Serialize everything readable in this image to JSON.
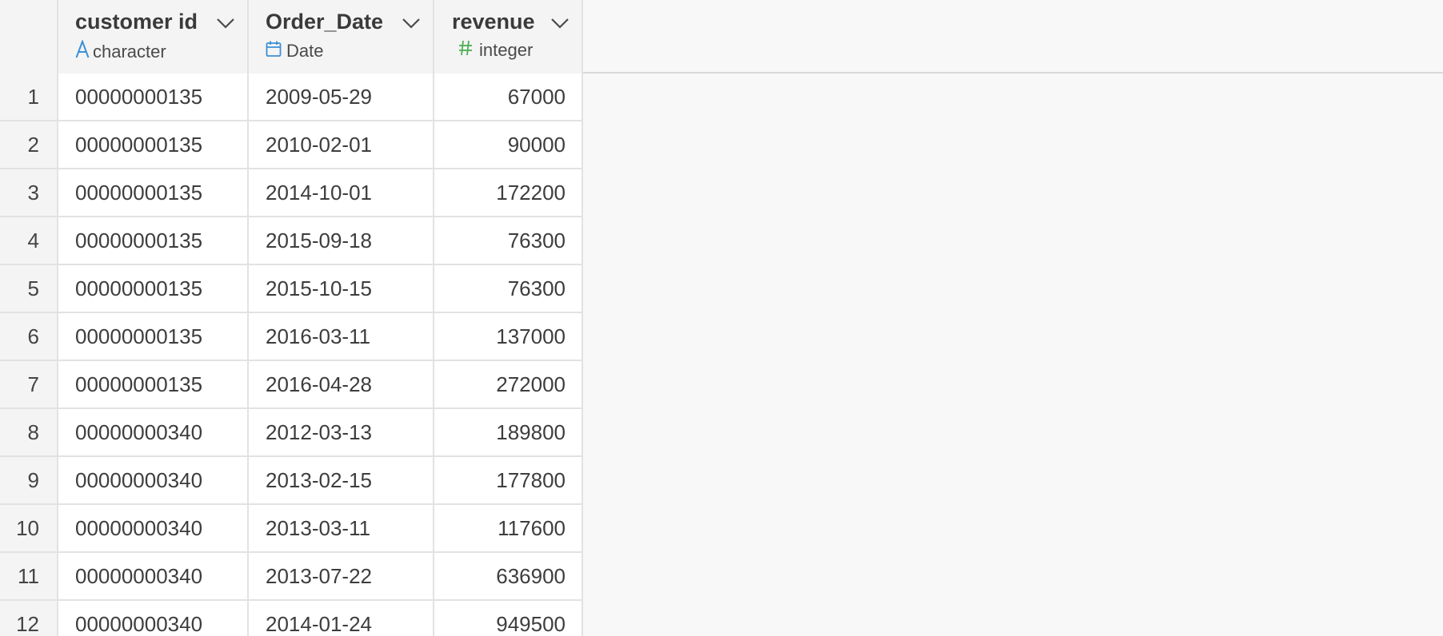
{
  "columns": [
    {
      "title": "customer id",
      "type": "character",
      "type_icon": "letter-a-icon"
    },
    {
      "title": "Order_Date",
      "type": "Date",
      "type_icon": "calendar-icon"
    },
    {
      "title": "revenue",
      "type": "integer",
      "type_icon": "hash-icon"
    }
  ],
  "type_colors": {
    "character": "#3b8fd6",
    "Date": "#3b8fd6",
    "integer": "#4caf50"
  },
  "rows": [
    {
      "index": "1",
      "customer_id": "00000000135",
      "order_date": "2009-05-29",
      "revenue": "67000"
    },
    {
      "index": "2",
      "customer_id": "00000000135",
      "order_date": "2010-02-01",
      "revenue": "90000"
    },
    {
      "index": "3",
      "customer_id": "00000000135",
      "order_date": "2014-10-01",
      "revenue": "172200"
    },
    {
      "index": "4",
      "customer_id": "00000000135",
      "order_date": "2015-09-18",
      "revenue": "76300"
    },
    {
      "index": "5",
      "customer_id": "00000000135",
      "order_date": "2015-10-15",
      "revenue": "76300"
    },
    {
      "index": "6",
      "customer_id": "00000000135",
      "order_date": "2016-03-11",
      "revenue": "137000"
    },
    {
      "index": "7",
      "customer_id": "00000000135",
      "order_date": "2016-04-28",
      "revenue": "272000"
    },
    {
      "index": "8",
      "customer_id": "00000000340",
      "order_date": "2012-03-13",
      "revenue": "189800"
    },
    {
      "index": "9",
      "customer_id": "00000000340",
      "order_date": "2013-02-15",
      "revenue": "177800"
    },
    {
      "index": "10",
      "customer_id": "00000000340",
      "order_date": "2013-03-11",
      "revenue": "117600"
    },
    {
      "index": "11",
      "customer_id": "00000000340",
      "order_date": "2013-07-22",
      "revenue": "636900"
    },
    {
      "index": "12",
      "customer_id": "00000000340",
      "order_date": "2014-01-24",
      "revenue": "949500"
    }
  ]
}
